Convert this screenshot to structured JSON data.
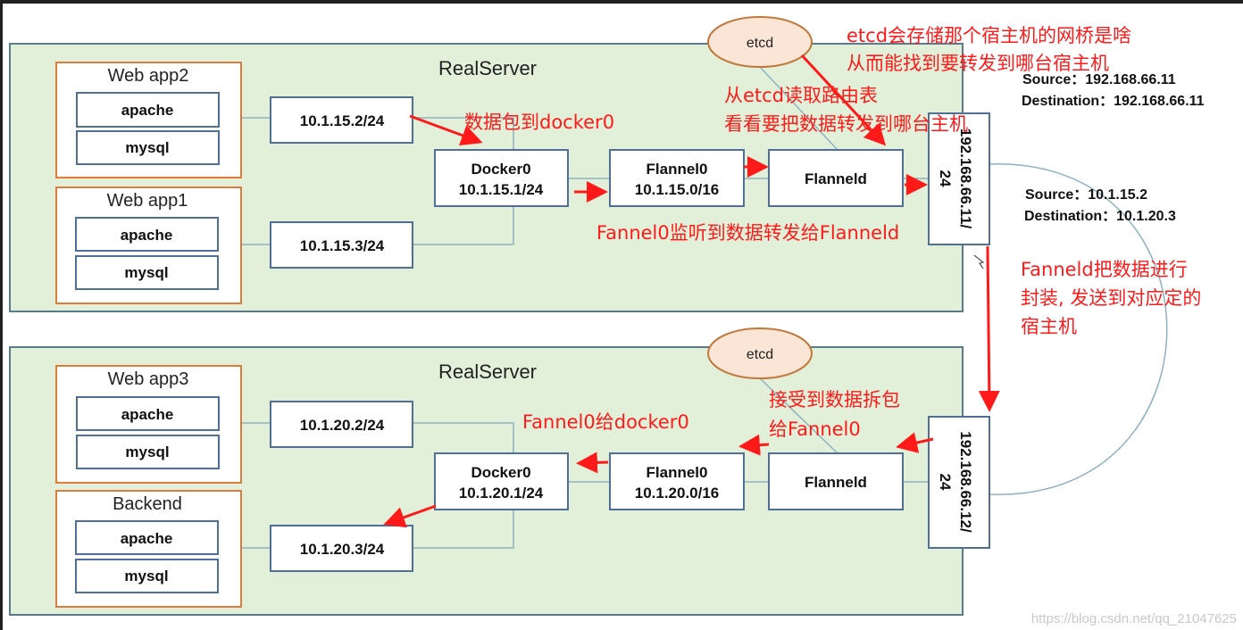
{
  "colors": {
    "panel": "#e2f0d9",
    "app_border": "#e07b39",
    "box_border": "#4f6f96",
    "etcd_fill": "#fbe5d6",
    "annotation": "#ff1a1a"
  },
  "top": {
    "server_label": "RealServer",
    "etcd": "etcd",
    "apps": [
      {
        "title": "Web app2",
        "services": [
          "apache",
          "mysql"
        ]
      },
      {
        "title": "Web app1",
        "services": [
          "apache",
          "mysql"
        ]
      }
    ],
    "veth": [
      "10.1.15.2/24",
      "10.1.15.3/24"
    ],
    "docker0": {
      "name": "Docker0",
      "ip": "10.1.15.1/24"
    },
    "flannel0": {
      "name": "Flannel0",
      "ip": "10.1.15.0/16"
    },
    "flanneld": "Flanneld",
    "host_ip": "192.168.66.11/",
    "host_mask": "24"
  },
  "bottom": {
    "server_label": "RealServer",
    "etcd": "etcd",
    "apps": [
      {
        "title": "Web app3",
        "services": [
          "apache",
          "mysql"
        ]
      },
      {
        "title": "Backend",
        "services": [
          "apache",
          "mysql"
        ]
      }
    ],
    "veth": [
      "10.1.20.2/24",
      "10.1.20.3/24"
    ],
    "docker0": {
      "name": "Docker0",
      "ip": "10.1.20.1/24"
    },
    "flannel0": {
      "name": "Flannel0",
      "ip": "10.1.20.0/16"
    },
    "flanneld": "Flanneld",
    "host_ip": "192.168.66.12/",
    "host_mask": "24"
  },
  "outer_packet": {
    "source": "Source：192.168.66.11",
    "destination": "Destination：192.168.66.11"
  },
  "inner_packet": {
    "source": "Source：10.1.15.2",
    "destination": "Destination：10.1.20.3"
  },
  "annotations": {
    "etcd_store": [
      "etcd会存储那个宿主机的网桥是啥",
      "从而能找到要转发到哪台宿主机"
    ],
    "read_route": [
      "从etcd读取路由表",
      "看看要把数据转发到哪台主机"
    ],
    "to_docker0": "数据包到docker0",
    "flannel0_listen": "Fannel0监听到数据转发给Flanneld",
    "encapsulate": [
      "Fanneld把数据进行",
      "封装, 发送到对应定的",
      "宿主机"
    ],
    "unpack": [
      "接受到数据拆包",
      "给Fannel0"
    ],
    "to_docker0_bottom": "Fannel0给docker0"
  },
  "watermark": "https://blog.csdn.net/qq_21047625"
}
